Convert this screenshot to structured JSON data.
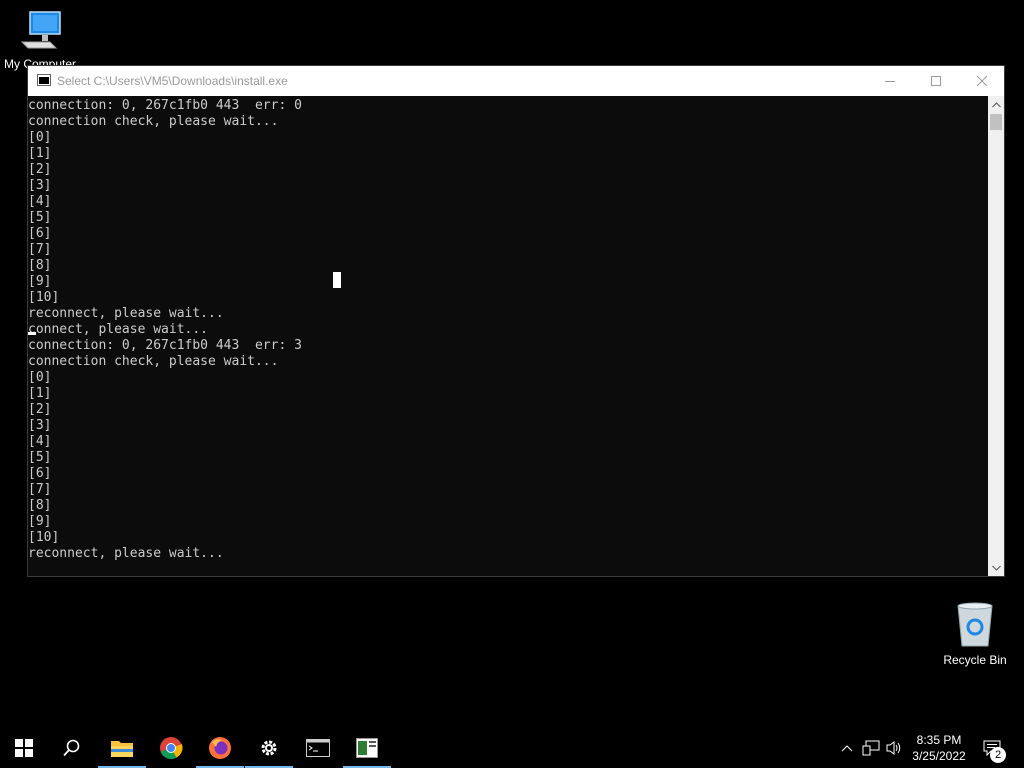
{
  "desktop": {
    "icons": [
      {
        "label": "My Computer"
      },
      {
        "label": "Recycle Bin"
      }
    ]
  },
  "window": {
    "title": "Select C:\\Users\\VM5\\Downloads\\install.exe",
    "lines": [
      "connection: 0, 267c1fb0 443  err: 0",
      "connection check, please wait...",
      "[0]",
      "[1]",
      "[2]",
      "[3]",
      "[4]",
      "[5]",
      "[6]",
      "[7]",
      "[8]",
      "[9]",
      "[10]",
      "reconnect, please wait...",
      "connect, please wait...",
      "connection: 0, 267c1fb0 443  err: 3",
      "connection check, please wait...",
      "[0]",
      "[1]",
      "[2]",
      "[3]",
      "[4]",
      "[5]",
      "[6]",
      "[7]",
      "[8]",
      "[9]",
      "[10]",
      "reconnect, please wait..."
    ]
  },
  "taskbar": {
    "apps": [
      {
        "name": "start",
        "icon": "windows-logo-icon"
      },
      {
        "name": "search",
        "icon": "search-icon"
      },
      {
        "name": "file-explorer",
        "icon": "folder-icon",
        "running": true
      },
      {
        "name": "chrome",
        "icon": "chrome-icon"
      },
      {
        "name": "firefox",
        "icon": "firefox-icon",
        "running": true
      },
      {
        "name": "settings",
        "icon": "gear-icon",
        "running": true
      },
      {
        "name": "command-prompt",
        "icon": "cmd-icon"
      },
      {
        "name": "app",
        "icon": "app-window-icon",
        "running": true
      }
    ],
    "time": "8:35 PM",
    "date": "3/25/2022",
    "notification_count": "2"
  },
  "colors": {
    "console_bg": "#0c0c0c",
    "console_text": "#cccccc",
    "taskbar_bg": "#000000",
    "active_indicator": "#76b9ed"
  }
}
